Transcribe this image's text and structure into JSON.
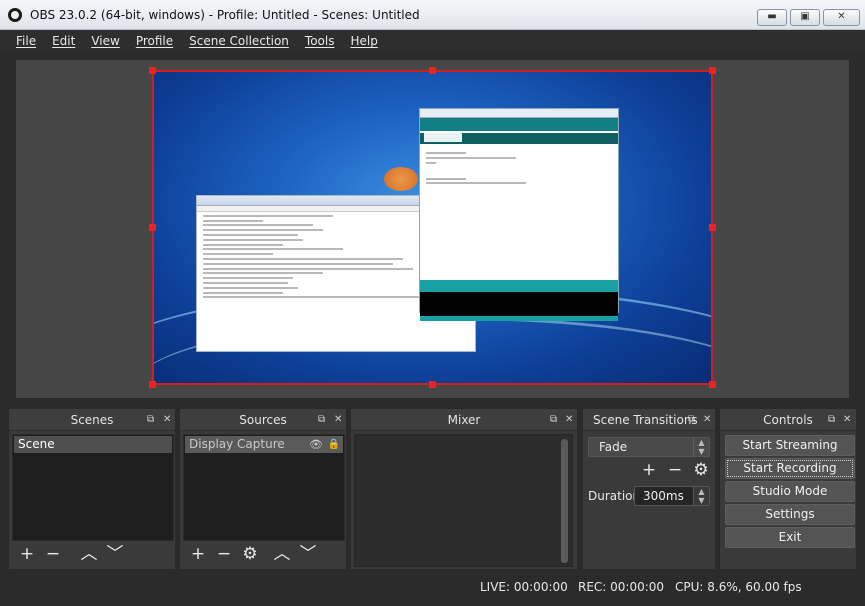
{
  "window": {
    "title": "OBS 23.0.2 (64-bit, windows) - Profile: Untitled - Scenes: Untitled",
    "min": "▬",
    "max": "▣",
    "close": "✕"
  },
  "menu": [
    "File",
    "Edit",
    "View",
    "Profile",
    "Scene Collection",
    "Tools",
    "Help"
  ],
  "docks": {
    "float_icon": "⧉",
    "close_icon": "✕",
    "scenes": {
      "title": "Scenes",
      "items": [
        "Scene"
      ]
    },
    "sources": {
      "title": "Sources",
      "items": [
        "Display Capture"
      ]
    },
    "mixer": {
      "title": "Mixer"
    },
    "transitions": {
      "title": "Scene Transitions",
      "selected": "Fade",
      "duration_label": "Duration",
      "duration_value": "300ms"
    },
    "controls": {
      "title": "Controls",
      "buttons": [
        "Start Streaming",
        "Start Recording",
        "Studio Mode",
        "Settings",
        "Exit"
      ]
    }
  },
  "glyphs": {
    "add": "+",
    "remove": "−",
    "up": "︿",
    "down": "﹀",
    "gear": "⚙",
    "eye": "👁",
    "lock": "🔒",
    "spin_up": "▲",
    "spin_down": "▼"
  },
  "status": {
    "live": "LIVE: 00:00:00",
    "rec": "REC: 00:00:00",
    "cpu": "CPU: 8.6%, 60.00 fps"
  },
  "colors": {
    "selection_border": "#d21e1e",
    "panel": "#3a3a3a",
    "accent_ide": "#17a1a5"
  }
}
